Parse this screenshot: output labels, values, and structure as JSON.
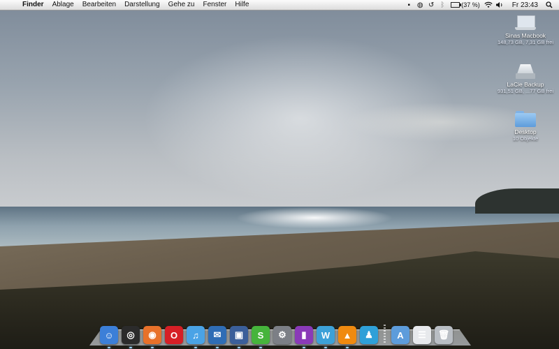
{
  "menubar": {
    "apple_icon": "apple-icon",
    "app_name": "Finder",
    "menus": [
      "Ablage",
      "Bearbeiten",
      "Darstellung",
      "Gehe zu",
      "Fenster",
      "Hilfe"
    ],
    "status_icons": [
      "time-machine-mini-icon",
      "globe-sync-icon",
      "history-icon",
      "bluetooth-icon"
    ],
    "battery_percent": "(37 %)",
    "battery_level": 0.37,
    "clock": "Fr 23:43"
  },
  "desktop_icons": [
    {
      "name": "Sinas Macbook",
      "info": "148,73 GB, 7,31 GB frei",
      "icon": "laptop-icon"
    },
    {
      "name": "LaCie Backup",
      "info": "931,51 GB, ...77 GB frei",
      "icon": "external-drive-icon"
    },
    {
      "name": "Desktop",
      "info": "10 Objekte",
      "icon": "folder-icon"
    }
  ],
  "dock": {
    "apps": [
      {
        "name": "finder",
        "glyph": "☺",
        "color": "#3c7fd8",
        "running": true
      },
      {
        "name": "dashboard",
        "glyph": "◎",
        "color": "#2b2b2b",
        "running": true
      },
      {
        "name": "firefox",
        "glyph": "◉",
        "color": "#e8712a",
        "running": true
      },
      {
        "name": "opera",
        "glyph": "O",
        "color": "#d61f26",
        "running": false
      },
      {
        "name": "itunes",
        "glyph": "♫",
        "color": "#4aa3e6",
        "running": true
      },
      {
        "name": "thunderbird",
        "glyph": "✉",
        "color": "#2f6db5",
        "running": true
      },
      {
        "name": "preview",
        "glyph": "▣",
        "color": "#3b5f9a",
        "running": true
      },
      {
        "name": "skype",
        "glyph": "S",
        "color": "#46b43c",
        "running": true
      },
      {
        "name": "system-preferences",
        "glyph": "⚙",
        "color": "#7c7f86",
        "running": false
      },
      {
        "name": "photo-app",
        "glyph": "▮",
        "color": "#8a3ab8",
        "running": true
      },
      {
        "name": "writer",
        "glyph": "W",
        "color": "#3da1d8",
        "running": true
      },
      {
        "name": "vlc",
        "glyph": "▲",
        "color": "#f08a10",
        "running": true
      },
      {
        "name": "messenger",
        "glyph": "♟",
        "color": "#2fa0d8",
        "running": false
      }
    ],
    "stack_items": [
      {
        "name": "applications-folder",
        "glyph": "A",
        "color": "#5d9cdb"
      },
      {
        "name": "documents-stack",
        "glyph": "☰",
        "color": "#e7e9ec"
      },
      {
        "name": "trash",
        "glyph": "🗑",
        "color": "#b9bec4"
      }
    ]
  }
}
